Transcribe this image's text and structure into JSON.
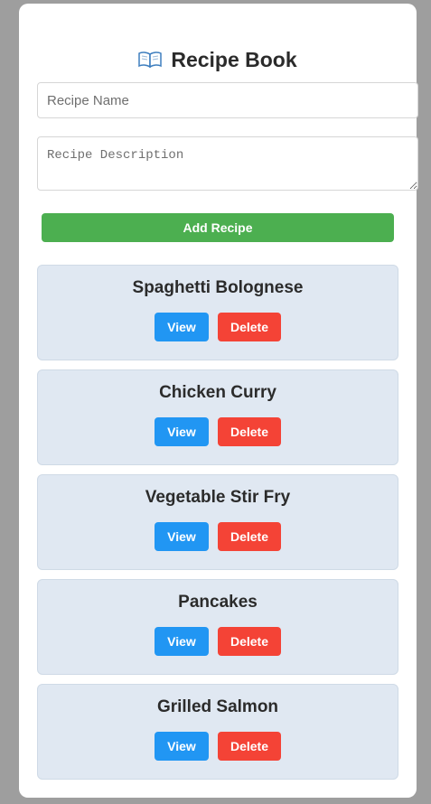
{
  "header": {
    "title": "Recipe Book",
    "icon": "open-book-icon"
  },
  "form": {
    "name_placeholder": "Recipe Name",
    "name_value": "",
    "description_placeholder": "Recipe Description",
    "description_value": "",
    "add_label": "Add Recipe"
  },
  "recipes": [
    {
      "name": "Spaghetti Bolognese",
      "view_label": "View",
      "delete_label": "Delete"
    },
    {
      "name": "Chicken Curry",
      "view_label": "View",
      "delete_label": "Delete"
    },
    {
      "name": "Vegetable Stir Fry",
      "view_label": "View",
      "delete_label": "Delete"
    },
    {
      "name": "Pancakes",
      "view_label": "View",
      "delete_label": "Delete"
    },
    {
      "name": "Grilled Salmon",
      "view_label": "View",
      "delete_label": "Delete"
    }
  ],
  "colors": {
    "page_background": "#9e9e9e",
    "card_background": "#ffffff",
    "add_button": "#4caf50",
    "view_button": "#2196f3",
    "delete_button": "#f44336",
    "recipe_item_background": "#e0e8f2"
  }
}
